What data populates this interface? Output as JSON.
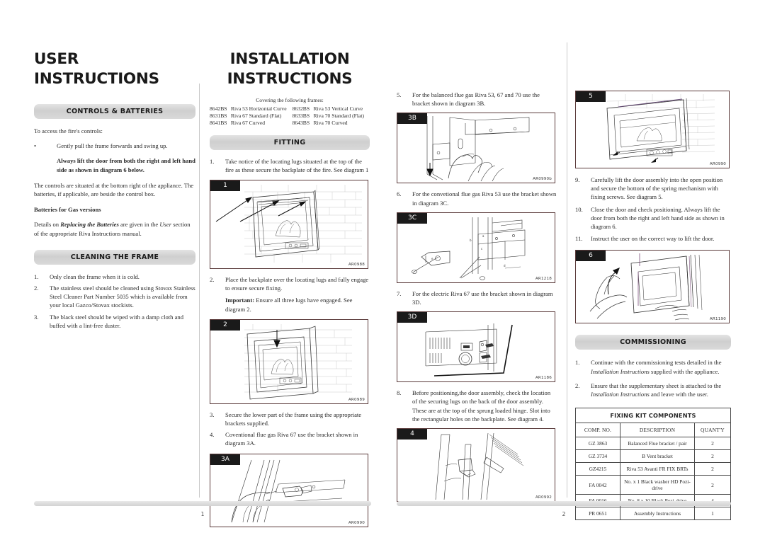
{
  "document": {
    "left_page": {
      "titles": [
        "USER INSTRUCTIONS",
        "INSTALLATION",
        "INSTRUCTIONS"
      ],
      "page_number": "1"
    },
    "right_page": {
      "page_number": "2"
    }
  },
  "col1": {
    "title": "USER INSTRUCTIONS",
    "section1": {
      "heading": "CONTROLS & BATTERIES",
      "intro": "To access the fire's controls:",
      "bullet": "Gently pull the frame forwards and swing up.",
      "bold_note": "Always lift the door from both the right and left hand side as shown in diagram 6 below.",
      "para2": "The controls are situated at the bottom right of the appliance. The batteries, if applicable, are beside the control box.",
      "subhead": "Batteries for Gas versions",
      "para3_a": "Details on ",
      "para3_b": "Replacing the Batteries",
      "para3_c": " are given in the ",
      "para3_d": "User",
      "para3_e": " section of the appropriate Riva Instructions manual."
    },
    "section2": {
      "heading": "CLEANING THE FRAME",
      "items": [
        {
          "num": "1.",
          "text": "Only clean the frame when it is cold."
        },
        {
          "num": "2.",
          "text": "The stainless steel should be cleaned using Stovax Stainless Steel Cleaner Part Number 5035 which is available from your local Gazco/Stovax stockists."
        },
        {
          "num": "3.",
          "text": "The black steel should be wiped with a damp cloth and buffed with a lint-free duster."
        }
      ]
    }
  },
  "col2": {
    "title_line1": "INSTALLATION",
    "title_line2": "INSTRUCTIONS",
    "frames_caption": "Covering the following frames:",
    "frames": [
      {
        "code_left": "8642BS",
        "name_left": "Riva 53 Horizontal Curve",
        "code_right": "8632BS",
        "name_right": "Riva 53 Vertical Curve"
      },
      {
        "code_left": "8631BS",
        "name_left": "Riva 67 Standard (Flat)",
        "code_right": "8633BS",
        "name_right": "Riva 70 Standard (Flat)"
      },
      {
        "code_left": "8641BS",
        "name_left": "Riva 67 Curved",
        "code_right": "8643BS",
        "name_right": "Riva 70 Curved"
      }
    ],
    "fitting_heading": "FITTING",
    "step1": {
      "num": "1.",
      "text": "Take notice of the locating lugs situated at the top of the fire as these secure the backplate of the fire. See diagram 1"
    },
    "fig1": {
      "tag": "1",
      "code": "AR0988"
    },
    "step2": {
      "num": "2.",
      "text": "Place the backplate over the locating lugs and fully engage to ensure secure fixing."
    },
    "step2_important_bold": "Important:",
    "step2_important_rest": " Ensure all three lugs have engaged. See diagram 2.",
    "fig2": {
      "tag": "2",
      "code": "AR0989"
    },
    "step3": {
      "num": "3.",
      "text": "Secure the lower part of the frame using the appropriate brackets supplied."
    },
    "step4": {
      "num": "4.",
      "text": "Coventional flue gas Riva 67 use the bracket shown in diagram 3A."
    },
    "fig3a": {
      "tag": "3A",
      "code": "AR0990"
    }
  },
  "col3": {
    "step5": {
      "num": "5.",
      "text": "For the balanced flue gas Riva 53, 67 and 70 use the bracket shown in diagram 3B."
    },
    "fig3b": {
      "tag": "3B",
      "code": "AR0990b"
    },
    "step6": {
      "num": "6.",
      "text": "For the convetional flue gas Riva 53 use the bracket shown in diagram 3C."
    },
    "fig3c": {
      "tag": "3C",
      "code": "AR1218"
    },
    "step7": {
      "num": "7.",
      "text": "For the electric Riva 67 use the bracket shown in diagram 3D."
    },
    "fig3d": {
      "tag": "3D",
      "code": "AR1186"
    },
    "step8": {
      "num": "8.",
      "text": "Before positioning,the door assembly, check the location of the securing lugs on the back of the door assembly. These are at the top of the sprung loaded hinge. Slot into the rectangular holes on the backplate. See diagram 4."
    },
    "fig4": {
      "tag": "4",
      "code": "AR0992"
    }
  },
  "col4": {
    "fig5": {
      "tag": "5",
      "code": "AR0990"
    },
    "step9": {
      "num": "9.",
      "text": "Carefully lift the door assembly into the open position and secure the bottom of the spring mechanism with fixing screws. See diagram 5."
    },
    "step10": {
      "num": "10.",
      "text": "Close the door and check positioning. Always lift the door from both the right and left hand side as shown in diagram 6."
    },
    "step11": {
      "num": "11.",
      "text": "Instruct the user on the correct way to lift the door."
    },
    "fig6": {
      "tag": "6",
      "code": "AR1190"
    },
    "commissioning_heading": "COMMISSIONING",
    "comm1_a": "Continue with the commissioning tests detailed in the ",
    "comm1_b": "Installation Instructions",
    "comm1_c": " supplied with the appliance.",
    "comm1_num": "1.",
    "comm2_a": "Ensure that the supplementary sheet is attached to the ",
    "comm2_b": "Installation Instructions",
    "comm2_c": " and leave with the user.",
    "comm2_num": "2.",
    "kit": {
      "title": "FIXING KIT COMPONENTS",
      "headers": [
        "COMP. NO.",
        "DESCRIPTION",
        "QUANT'Y"
      ],
      "rows": [
        {
          "comp": "GZ 3863",
          "desc": "Balanced Flue bracket / pair",
          "qty": "2"
        },
        {
          "comp": "GZ 3734",
          "desc": "B Vent bracket",
          "qty": "2"
        },
        {
          "comp": "GZ4215",
          "desc": "Riva 53 Avanti FR FIX BRTs",
          "qty": "2"
        },
        {
          "comp": "FA 0042",
          "desc": "No. x 1 Black washer HD Pozi-drive",
          "qty": "2"
        },
        {
          "comp": "FA 0016",
          "desc": "No. 8 x 10 Black Pozi-drive",
          "qty": "4"
        },
        {
          "comp": "PR 0651",
          "desc": "Assembly Instructions",
          "qty": "1"
        }
      ]
    }
  }
}
